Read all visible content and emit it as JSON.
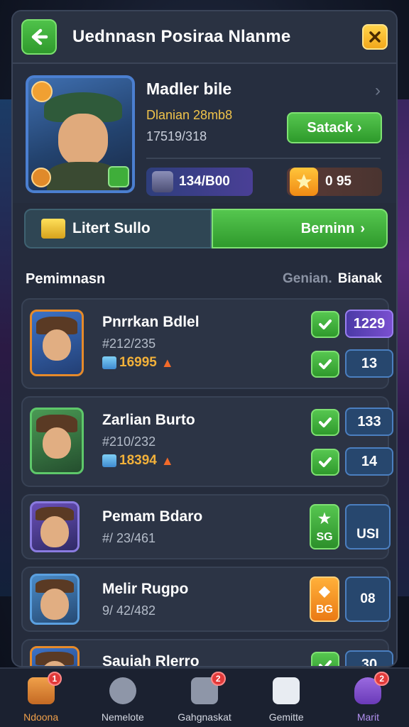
{
  "header": {
    "title": "Uednnasn Posiraa Nlanme"
  },
  "profile": {
    "name": "Madler bile",
    "subtitle": "Dlanian 28mb8",
    "id": "17519/318",
    "attack_label": "Satack",
    "stat_a": "134/B00",
    "stat_b": "0 95"
  },
  "actions": {
    "left_label": "Litert Sullo",
    "right_label": "Berninn"
  },
  "list": {
    "title": "Pemimnasn",
    "col1": "Genian.",
    "col2": "Bianak",
    "rows": [
      {
        "name": "Pnrrkan Bdlel",
        "sub": "#212/235",
        "power": "16995",
        "v1": "1229",
        "v2": "13"
      },
      {
        "name": "Zarlian Burto",
        "sub": "#210/232",
        "power": "18394",
        "v1": "133",
        "v2": "14"
      },
      {
        "name": "Pemam Bdaro",
        "sub": "#/ 23/461",
        "tile_label": "SG",
        "box_label": "USI"
      },
      {
        "name": "Melir Rugpo",
        "sub": "9/ 42/482",
        "tile_label": "BG",
        "box_label": "08"
      },
      {
        "name": "Sauiah Rlerro",
        "sub": "",
        "v1": "30"
      }
    ]
  },
  "nav": {
    "items": [
      {
        "label": "Ndoona",
        "badge": "1"
      },
      {
        "label": "Nemelote",
        "badge": ""
      },
      {
        "label": "Gahgnaskat",
        "badge": "2"
      },
      {
        "label": "Gemitte",
        "badge": ""
      },
      {
        "label": "Marit",
        "badge": "2"
      }
    ]
  },
  "colors": {
    "accent_green": "#4fc24a",
    "accent_gold": "#f0c34a",
    "panel_bg": "#252c3c"
  }
}
